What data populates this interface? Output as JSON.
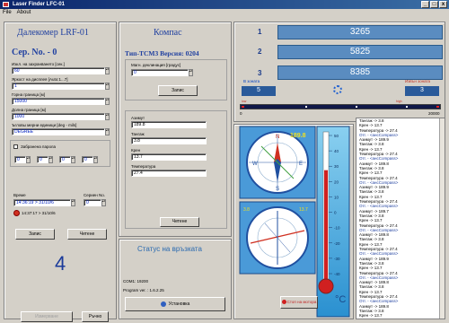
{
  "window": {
    "title": "Laser Finder LFC-01",
    "min": "_",
    "max": "□",
    "close": "x"
  },
  "menu": [
    "File",
    "About"
  ],
  "left": {
    "title": "Далекомер LRF-01",
    "serial": "Сер. No. - 0",
    "fields": [
      {
        "label": "Изкл. на захранването [сек.]",
        "value": "60"
      },
      {
        "label": "Яркост на дисплея [Auto:1...7]",
        "value": "1"
      },
      {
        "label": "Горна граница [м]",
        "value": "15000"
      },
      {
        "label": "Долна граница [м]",
        "value": "1000"
      },
      {
        "label": "Ъгловы мерни единици [deg - mils]",
        "value": "DEGREE"
      }
    ],
    "password_check": "Забранена парола",
    "password_digits": [
      "0",
      "0",
      "0",
      "0"
    ],
    "time_label": "Време",
    "time_value": "14:36:19 > 31/10/6",
    "clock_value": "14:37:17 > 31/10/6",
    "serial_no_label": "Сериен No.",
    "serial_no_value": "0",
    "write_button": "Запис",
    "read_button": "Четене",
    "big_number": "4",
    "measure_button": "Измерване",
    "manual_button": "Ръчно"
  },
  "compass": {
    "title": "Компас",
    "type_version": "Тип-TCM3 Версия: 0204",
    "magnetic_label": "Магн. деклинация [градус]",
    "magnetic_value": "0",
    "write_button": "Запис",
    "readings": [
      {
        "label": "Азимут",
        "value": "189.8"
      },
      {
        "label": "Тангаж",
        "value": "3.8"
      },
      {
        "label": "Крен",
        "value": "13.7"
      },
      {
        "label": "Температура",
        "value": "27.4"
      }
    ],
    "read_button": "Четене"
  },
  "connection": {
    "title": "Статус на връзката",
    "com": "COM1: 19200",
    "program": "Program ver. : 1.6.2.25",
    "start_button": "Установка"
  },
  "distances": [
    {
      "index": "1",
      "value": "3265"
    },
    {
      "index": "2",
      "value": "5825"
    },
    {
      "index": "3",
      "value": "8385"
    }
  ],
  "zone": {
    "in_label": "В зоната",
    "in_value": "5",
    "out_label": "Извън зоната",
    "out_value": "3",
    "scale_min": "0",
    "scale_max": "20000",
    "low_label": "low",
    "high_label": "high"
  },
  "dials": {
    "azimuth": "189.8",
    "pitch": "3.8",
    "roll": "13.7",
    "north": "N",
    "east": "E",
    "west": "W",
    "south": "S"
  },
  "thermometer": {
    "unit": "°C",
    "ticks": [
      "50",
      "40",
      "30",
      "20",
      "10",
      "0",
      "-10",
      "-20",
      "-30",
      "-40"
    ],
    "value": 27.4
  },
  "stop_button": "Стоп на мотора",
  "log": [
    "Тангаж -> 3.8",
    "Крен -> 13.7",
    "Температура -> 27.4",
    "Отг. - <ансCompass>",
    "Азимут -> 189.9",
    "Тангаж -> 3.8",
    "Крен -> 13.7",
    "Температура -> 27.4",
    "Отг. - <ансCompass>",
    "Азимут -> 189.8",
    "Тангаж -> 3.8",
    "Крен -> 13.7",
    "Температура -> 27.4",
    "Отг. - <ансCompass>",
    "Азимут -> 189.9",
    "Тангаж -> 3.8",
    "Крен -> 13.7",
    "Температура -> 27.4",
    "Отг. - <ансCompass>",
    "Азимут -> 189.7",
    "Тангаж -> 3.8",
    "Крен -> 13.7",
    "Температура -> 27.4",
    "Отг. - <ансCompass>",
    "Азимут -> 189.8",
    "Тангаж -> 3.8",
    "Крен -> 13.7",
    "Температура -> 27.4",
    "Отг. - <ансCompass>",
    "Азимут -> 189.9",
    "Тангаж -> 3.8",
    "Крен -> 13.7",
    "Температура -> 27.4",
    "Отг. - <ансCompass>",
    "Азимут -> 189.8",
    "Тангаж -> 3.8",
    "Крен -> 13.7",
    "Температура -> 27.4",
    "Отг. - <ансCompass>",
    "Азимут -> 189.8",
    "Тангаж -> 3.8",
    "Крен -> 13.7"
  ]
}
